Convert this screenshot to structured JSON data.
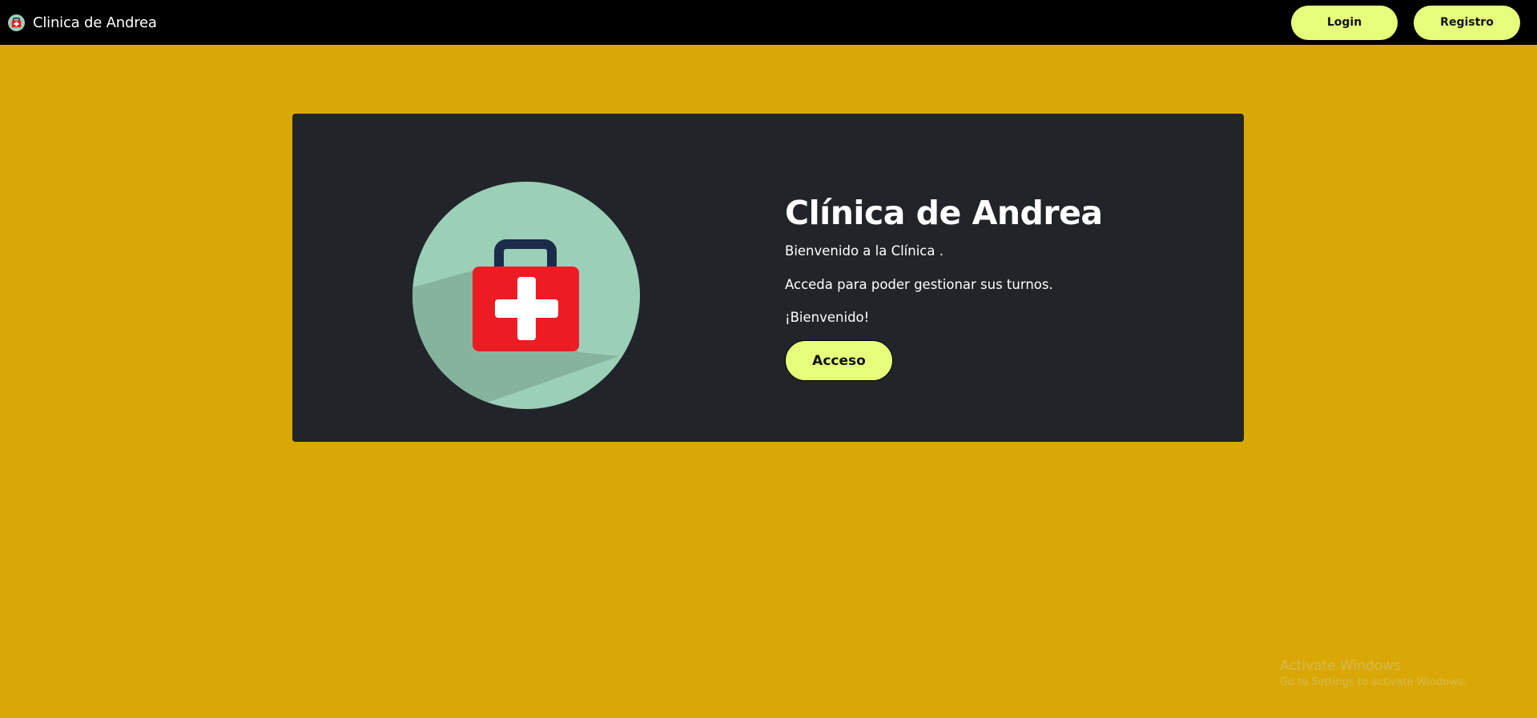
{
  "navbar": {
    "brand_text": "Clinica de Andrea",
    "brand_icon": "first-aid-logo-icon",
    "buttons": {
      "login": "Login",
      "registro": "Registro"
    }
  },
  "hero": {
    "image_icon": "first-aid-kit-icon",
    "title": "Clínica de Andrea",
    "paragraphs": [
      "Bienvenido a la Clínica .",
      "Acceda para poder gestionar sus turnos.",
      "¡Bienvenido!"
    ],
    "cta_label": "Acceso"
  },
  "watermark": {
    "title": "Activate Windows",
    "subtitle": "Go to Settings to activate Windows."
  },
  "colors": {
    "page_background": "#d9a806",
    "navbar_background": "#000000",
    "card_background": "#212529",
    "button_accent": "#e6ff7a",
    "icon_circle": "#9bcfb8",
    "kit_red": "#ed1c24",
    "kit_handle": "#1b2c4a"
  }
}
